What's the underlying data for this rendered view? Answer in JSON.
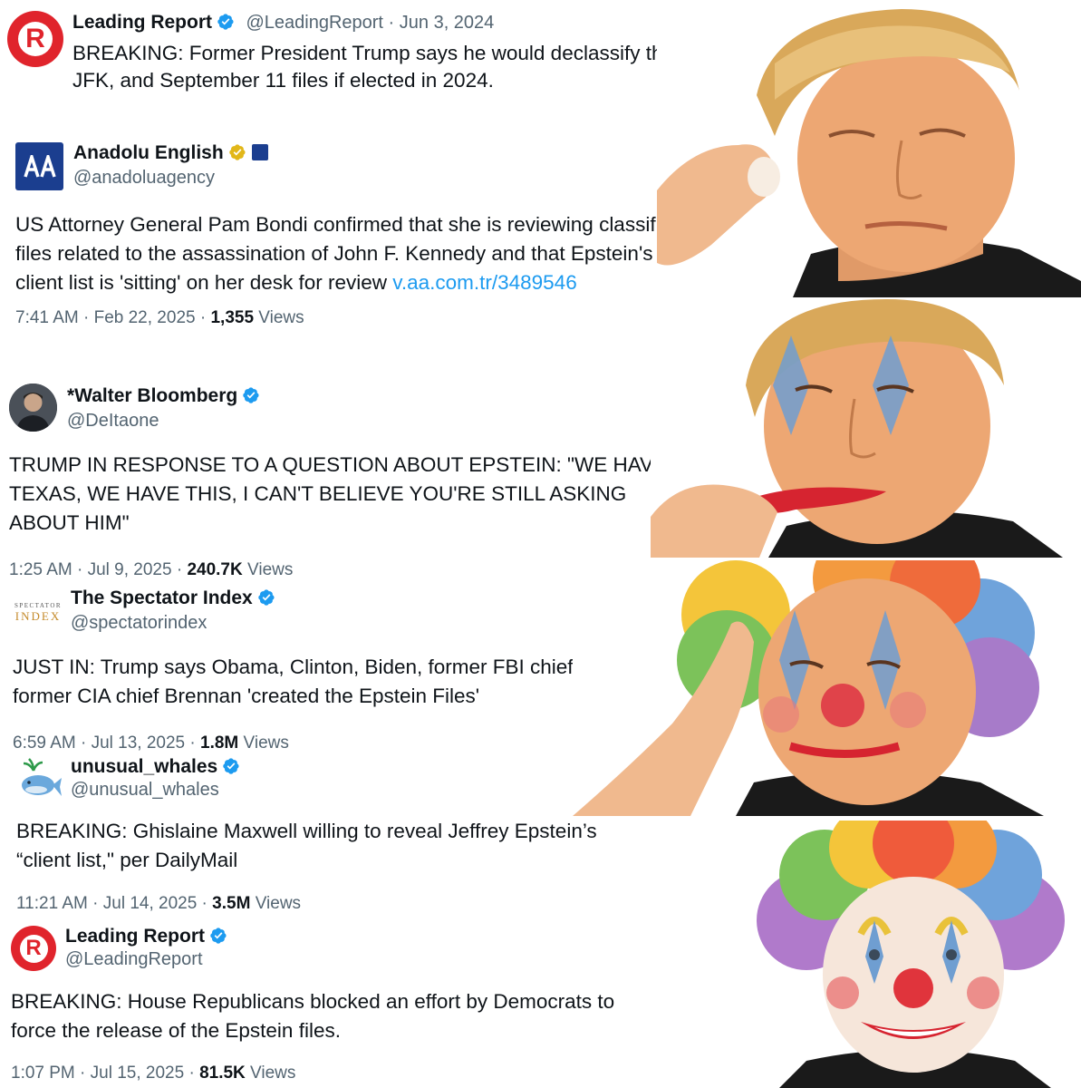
{
  "tweets": [
    {
      "name": "Leading Report",
      "handle": "@LeadingReport",
      "date": "Jun 3, 2024",
      "text": "BREAKING: Former President Trump says he would declassify the Epstein, JFK, and September 11 files if elected in 2024."
    },
    {
      "name": "Anadolu English",
      "handle": "@anadoluagency",
      "text": "US Attorney General Pam Bondi confirmed that she is reviewing classified files related to the assassination of John F. Kennedy and that Epstein's client list is 'sitting' on her desk for review ",
      "link": "v.aa.com.tr/3489546",
      "time": "7:41 AM · Feb 22, 2025 · ",
      "views": "1,355",
      "views_label": "Views"
    },
    {
      "name": "*Walter Bloomberg",
      "handle": "@DeItaone",
      "text": "TRUMP IN RESPONSE TO A QUESTION ABOUT EPSTEIN: \"WE HAVE TEXAS, WE HAVE THIS, I CAN'T BELIEVE YOU'RE STILL ASKING ABOUT HIM\"",
      "time": "1:25 AM · Jul 9, 2025 · ",
      "views": "240.7K",
      "views_label": "Views"
    },
    {
      "name": "The Spectator Index",
      "handle": "@spectatorindex",
      "text": "JUST IN: Trump says Obama, Clinton, Biden, former FBI chief Comey and former CIA chief Brennan 'created the Epstein Files'",
      "time": "6:59 AM · Jul 13, 2025 · ",
      "views": "1.8M",
      "views_label": "Views",
      "avatar_top": "SPECTATOR",
      "avatar_bottom": "INDEX"
    },
    {
      "name": "unusual_whales",
      "handle": "@unusual_whales",
      "text": "BREAKING: Ghislaine Maxwell willing to reveal Jeffrey Epstein’s “client list,\" per DailyMail",
      "time": "11:21 AM · Jul 14, 2025 · ",
      "views": "3.5M",
      "views_label": "Views"
    },
    {
      "name": "Leading Report",
      "handle": "@LeadingReport",
      "text": "BREAKING: House Republicans blocked an effort by Democrats to force the release of the Epstein files.",
      "time": "1:07 PM · Jul 15, 2025 · ",
      "views": "81.5K",
      "views_label": "Views"
    }
  ],
  "colors": {
    "verified_blue": "#1d9bf0",
    "verified_gold": "#e2b719",
    "leading_red": "#e0242c",
    "anadolu_blue": "#1b3e8f"
  },
  "panels": [
    {
      "stage": "plain face, applying makeup sponge"
    },
    {
      "stage": "blue clown eye paint, red lipstick"
    },
    {
      "stage": "clown paint, red nose, rainbow wig"
    },
    {
      "stage": "full clown makeup and rainbow wig, smiling"
    }
  ]
}
